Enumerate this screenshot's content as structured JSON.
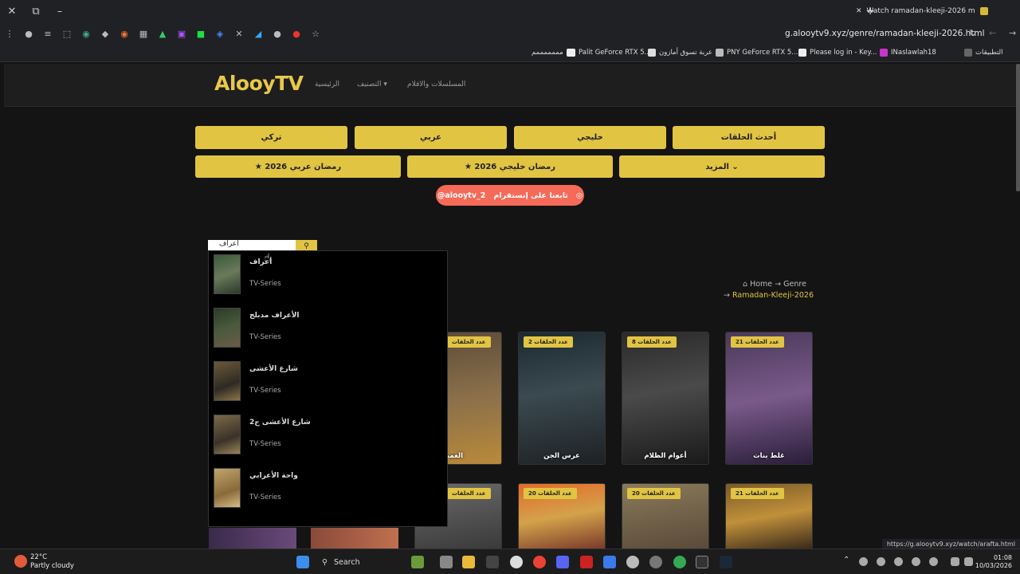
{
  "browser": {
    "tab_title": "Watch ramadan-kleeji-2026 m",
    "url": "g.alooytv9.xyz/genre/ramadan-kleeji-2026.html",
    "bookmarks": [
      "التطبيقات",
      "INaslawlah18",
      "Please log in - Key...",
      "PNY GeForce RTX 5...",
      "عربة تسوق أمازون",
      "Palit GeForce RTX 5...",
      "مممممممم"
    ]
  },
  "site": {
    "logo": "AlooyTV",
    "nav": [
      "الرئيسية",
      "التصنيف ▾",
      "المسلسلات والافلام"
    ],
    "categories_row1": [
      "تركي",
      "عربي",
      "خليجي",
      "أحدث الحلقات"
    ],
    "categories_row2": [
      "★ رمضان عربي 2026",
      "★ رمضان خليجي 2026",
      "المزيد ⌄"
    ],
    "instagram_label": "تابعنا على إنستقرام",
    "instagram_handle": "@alooytv_2"
  },
  "search": {
    "value": "أعراف"
  },
  "results": [
    {
      "title": "أعراف",
      "type": "TV-Series"
    },
    {
      "title": "الأعراف مدبلج",
      "type": "TV-Series"
    },
    {
      "title": "شارع الأعشى",
      "type": "TV-Series"
    },
    {
      "title": "شارع الأعشى ج2",
      "type": "TV-Series"
    },
    {
      "title": "واحة الأعرابي",
      "type": "TV-Series"
    }
  ],
  "breadcrumb": {
    "home": "Home",
    "genre": "Genre",
    "current": "Ramadan-Kleeji-2026"
  },
  "cards": [
    {
      "name": "الغميضة",
      "badge": "عدد الحلقات"
    },
    {
      "name": "عرس الجن",
      "badge": "عدد الحلقات 2"
    },
    {
      "name": "أعوام الظلام",
      "badge": "عدد الحلقات 8"
    },
    {
      "name": "غلط بنات",
      "badge": "عدد الحلقات 21"
    }
  ],
  "cards_row2_badges": [
    "عدد الحلقات",
    "عدد الحلقات 20",
    "عدد الحلقات 20",
    "عدد الحلقات 21"
  ],
  "status_url": "https://g.alooytv9.xyz/watch/arafta.html",
  "taskbar": {
    "temp": "22°C",
    "weather": "Partly cloudy",
    "search": "Search",
    "time": "01:08",
    "date": "10/03/2026"
  }
}
